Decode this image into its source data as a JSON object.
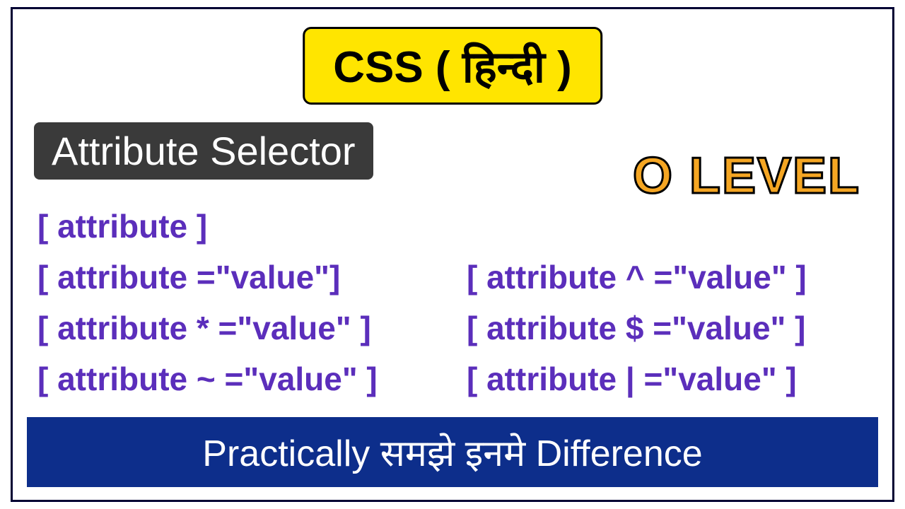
{
  "title": "CSS ( हिन्दी )",
  "subtitle": "Attribute Selector",
  "level": "O LEVEL",
  "selectors": {
    "s1": "[ attribute ]",
    "s2": "[ attribute =\"value\"]",
    "s3": "[ attribute ^ =\"value\" ]",
    "s4": "[ attribute * =\"value\" ]",
    "s5": "[ attribute $ =\"value\" ]",
    "s6": "[ attribute ~ =\"value\"  ]",
    "s7": "[ attribute | =\"value\" ]"
  },
  "footer": "Practically समझे इनमे Difference"
}
